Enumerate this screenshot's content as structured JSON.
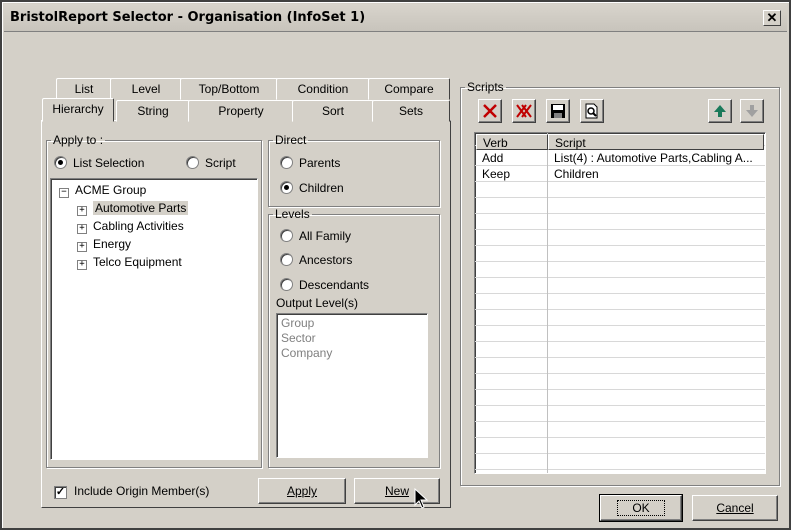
{
  "window": {
    "title": "BristolReport Selector - Organisation (InfoSet 1)",
    "close_glyph": "✕"
  },
  "tabs": {
    "row1": [
      "List",
      "Level",
      "Top/Bottom",
      "Condition",
      "Compare"
    ],
    "row2": [
      "Hierarchy",
      "String",
      "Property",
      "Sort",
      "Sets"
    ],
    "active": "Hierarchy"
  },
  "apply_to": {
    "label": "Apply to :",
    "options": [
      "List Selection",
      "Script"
    ],
    "selected": "List Selection"
  },
  "tree": {
    "root": {
      "expander": "−",
      "label": "ACME Group"
    },
    "children": [
      {
        "expander": "+",
        "label": "Automotive Parts",
        "selected": true
      },
      {
        "expander": "+",
        "label": "Cabling Activities"
      },
      {
        "expander": "+",
        "label": "Energy"
      },
      {
        "expander": "+",
        "label": "Telco Equipment"
      }
    ]
  },
  "direct": {
    "label": "Direct",
    "options": [
      "Parents",
      "Children"
    ],
    "selected": "Children"
  },
  "levels": {
    "label": "Levels",
    "options": [
      "All Family",
      "Ancestors",
      "Descendants"
    ],
    "output_label": "Output Level(s)",
    "output_items": [
      "Group",
      "Sector",
      "Company"
    ]
  },
  "include_origin": {
    "label": "Include Origin Member(s)",
    "checked": true,
    "mark": "✓"
  },
  "buttons": {
    "apply": "Apply",
    "new": "New",
    "ok": "OK",
    "cancel": "Cancel"
  },
  "scripts": {
    "label": "Scripts",
    "toolbar_icons": [
      "delete-icon",
      "delete-all-icon",
      "save-icon",
      "preview-icon",
      "move-up-icon",
      "move-down-icon"
    ],
    "columns": [
      "Verb",
      "Script"
    ],
    "rows": [
      {
        "verb": "Add",
        "script": "List(4) : Automotive Parts,Cabling A..."
      },
      {
        "verb": "Keep",
        "script": "Children"
      }
    ]
  }
}
